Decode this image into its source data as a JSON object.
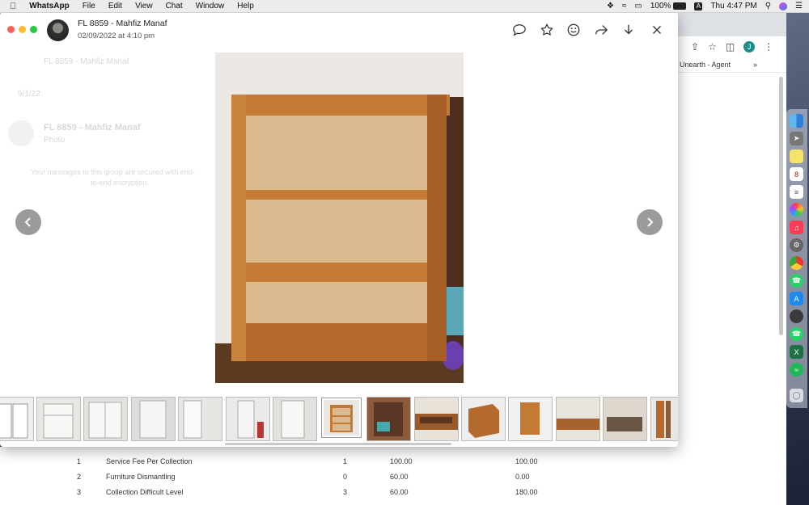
{
  "menubar": {
    "app_name": "WhatsApp",
    "items": [
      "File",
      "Edit",
      "View",
      "Chat",
      "Window",
      "Help"
    ],
    "battery": "100%",
    "clock": "Thu 4:47 PM"
  },
  "viewer": {
    "contact_name": "FL 8859 - Mahfiz Manaf",
    "timestamp": "02/09/2022 at 4:10 pm",
    "thumbnail_count": 15,
    "selected_thumbnail": 7
  },
  "ghost": {
    "search": "FL 8859 - Mahfiz Manaf",
    "date": "9/1/22",
    "chat_name": "FL 8859 - Mahfiz Manaf",
    "chat_preview": "Photo",
    "info_line1": "Your messages to this group are secured with end-",
    "info_line2": "to-end encryption."
  },
  "chrome": {
    "bookmark": "Unearth - Agent",
    "profile_letter": "J"
  },
  "document": {
    "rows": [
      {
        "no": "1",
        "desc": "Service Fee Per Collection",
        "qty": "1",
        "rate": "100.00",
        "amount": "100.00"
      },
      {
        "no": "2",
        "desc": "Furniture Dismantling",
        "qty": "0",
        "rate": "60.00",
        "amount": "0.00"
      },
      {
        "no": "3",
        "desc": "Collection Difficult Level",
        "qty": "3",
        "rate": "60.00",
        "amount": "180.00"
      }
    ]
  },
  "colors": {
    "wood": "#c27a34",
    "back_panel": "#d9b98d",
    "nav_button": "#9b9b9b"
  }
}
